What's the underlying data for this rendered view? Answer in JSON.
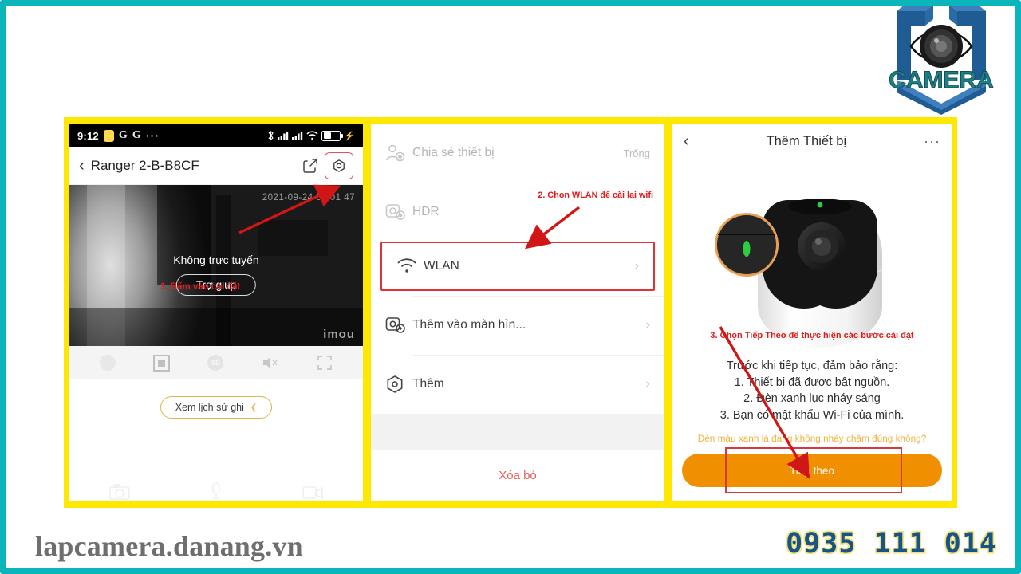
{
  "brand": {
    "logo_text": "CAMERA",
    "website": "lapcamera.danang.vn",
    "phone": "0935 111 014",
    "colors": {
      "frame_teal": "#0bb5bc",
      "highlight_yellow": "#ffe800",
      "annotation_red": "#e01b1b",
      "button_orange": "#f09000",
      "logo_blue": "#1f5c94"
    }
  },
  "panel1": {
    "status_bar": {
      "time": "9:12",
      "left_icons": [
        "sim-chip-icon",
        "google-icon",
        "google-icon",
        "more-dots-icon"
      ],
      "right_icons": [
        "bluetooth-icon",
        "signal-bars-icon",
        "signal-bars-icon",
        "wifi-icon",
        "battery-charging-icon"
      ]
    },
    "app_bar": {
      "back_label": "‹",
      "title": "Ranger 2-B-B8CF",
      "share_icon": "share-icon",
      "settings_icon": "gear-icon"
    },
    "video": {
      "timestamp": "2021-09-24 06 01 47",
      "offline_text": "Không trực tuyến",
      "help_button": "Trợ giúp",
      "watermark": "imou",
      "annotation": "1. Bấm vào cài đặt"
    },
    "controls": [
      "record-dot-icon",
      "snapshot-icon",
      "sd-quality-icon",
      "mute-speaker-icon",
      "fullscreen-icon"
    ],
    "history_button": "Xem lịch sử ghi",
    "bottom_nav": [
      "camera-icon",
      "microphone-icon",
      "video-clip-icon"
    ]
  },
  "panel2": {
    "annotation": "2. Chọn WLAN để cài lại wifi",
    "rows": [
      {
        "icon": "share-device-icon",
        "label": "Chia sẻ thiết bị",
        "value": "Trống",
        "dim": true
      },
      {
        "icon": "hdr-icon",
        "label": "HDR",
        "value": "",
        "dim": true
      },
      {
        "icon": "wifi-icon",
        "label": "WLAN",
        "value": "",
        "dim": false
      },
      {
        "icon": "add-to-home-icon",
        "label": "Thêm vào màn hìn...",
        "value": "",
        "dim": false
      },
      {
        "icon": "more-settings-icon",
        "label": "Thêm",
        "value": "",
        "dim": false
      }
    ],
    "delete_button": "Xóa bỏ"
  },
  "panel3": {
    "header": {
      "back_label": "‹",
      "title": "Thêm Thiết bị",
      "menu_icon": "more-dots-icon"
    },
    "annotation": "3. Chọn Tiếp Theo để thực hiện các bước cài đặt",
    "instructions": [
      "Trước khi tiếp tục, đảm bảo rằng:",
      "1. Thiết bị đã được bật nguồn.",
      "2. Đèn xanh lục nháy sáng",
      "3. Bạn có mật khẩu Wi-Fi của mình."
    ],
    "question": "Đèn màu xanh lá đang không nháy chậm đúng không?",
    "next_button": "Tiếp theo"
  }
}
